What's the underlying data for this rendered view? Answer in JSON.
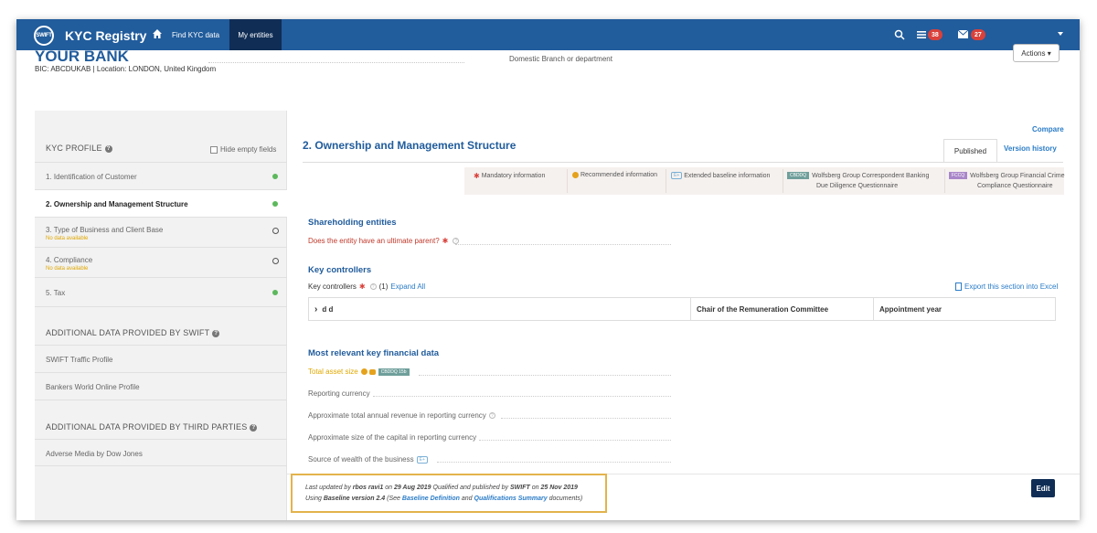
{
  "nav": {
    "logo_text": "SWIFT",
    "brand": "KYC Registry",
    "find_kyc": "Find KYC data",
    "my_entities": "My entities",
    "badge_list": "38",
    "badge_mail": "27"
  },
  "header": {
    "bank_name": "YOUR BANK",
    "bic_location": "BIC: ABCDUKAB    | Location: LONDON, United Kingdom",
    "branch": "Domestic Branch or department",
    "actions": "Actions ▾"
  },
  "sidebar": {
    "kyc_profile": "KYC PROFILE",
    "hide_empty": "Hide empty fields",
    "items": [
      {
        "label": "1. Identification of Customer",
        "sub": "",
        "status": "complete"
      },
      {
        "label": "2. Ownership and Management Structure",
        "sub": "",
        "status": "complete"
      },
      {
        "label": "3. Type of Business and Client Base",
        "sub": "No data available",
        "status": "empty"
      },
      {
        "label": "4. Compliance",
        "sub": "No data available",
        "status": "empty"
      },
      {
        "label": "5. Tax",
        "sub": "",
        "status": "complete"
      }
    ],
    "additional_swift": "ADDITIONAL DATA PROVIDED BY SWIFT",
    "swift_items": [
      "SWIFT Traffic Profile",
      "Bankers World Online Profile"
    ],
    "additional_third": "ADDITIONAL DATA PROVIDED BY THIRD PARTIES",
    "third_items": [
      "Adverse Media by Dow Jones"
    ]
  },
  "main": {
    "compare": "Compare",
    "title": "2. Ownership and Management Structure",
    "tab_published": "Published",
    "tab_history": "Version history",
    "legend": {
      "mandatory": "Mandatory information",
      "recommended": "Recommended information",
      "ext_tag": "E+",
      "extended": "Extended baseline information",
      "cbddq_tag": "CBDDQ",
      "cbddq_line1": "Wolfsberg Group Correspondent Banking",
      "cbddq_line2": "Due Diligence Questionnaire",
      "fccq_tag": "FCCQ",
      "fccq_line1": "Wolfsberg Group Financial Crime",
      "fccq_line2": "Compliance Questionnaire"
    },
    "shareholding": {
      "title": "Shareholding entities",
      "question": "Does the entity have an ultimate parent?"
    },
    "key_controllers": {
      "title": "Key controllers",
      "label": "Key controllers",
      "count": "(1)",
      "expand": "Expand All",
      "export": "Export this section into Excel",
      "row_name": "d d",
      "col_role": "Chair of the Remuneration Committee",
      "col_year": "Appointment year"
    },
    "financial": {
      "title": "Most relevant key financial data",
      "total_asset": "Total asset size",
      "total_asset_tag": "CBDDQ 15b",
      "reporting_currency": "Reporting currency",
      "annual_revenue": "Approximate total annual revenue in reporting currency",
      "capital_size": "Approximate size of the capital in reporting currency",
      "source_wealth": "Source of wealth of the business",
      "ext_tag": "E+"
    },
    "footer": {
      "pre": "Last updated by",
      "user": "rbos ravi1",
      "on1": "on",
      "date1": "29 Aug 2019",
      "mid": "Qualified and published by",
      "publisher": "SWIFT",
      "on2": "on",
      "date2": "25 Nov 2019",
      "using": "Using",
      "baseline": "Baseline version 2.4",
      "see": "(See",
      "link1": "Baseline Definition",
      "and": "and",
      "link2": "Qualifications Summary",
      "docs": "documents)"
    },
    "edit": "Edit"
  }
}
